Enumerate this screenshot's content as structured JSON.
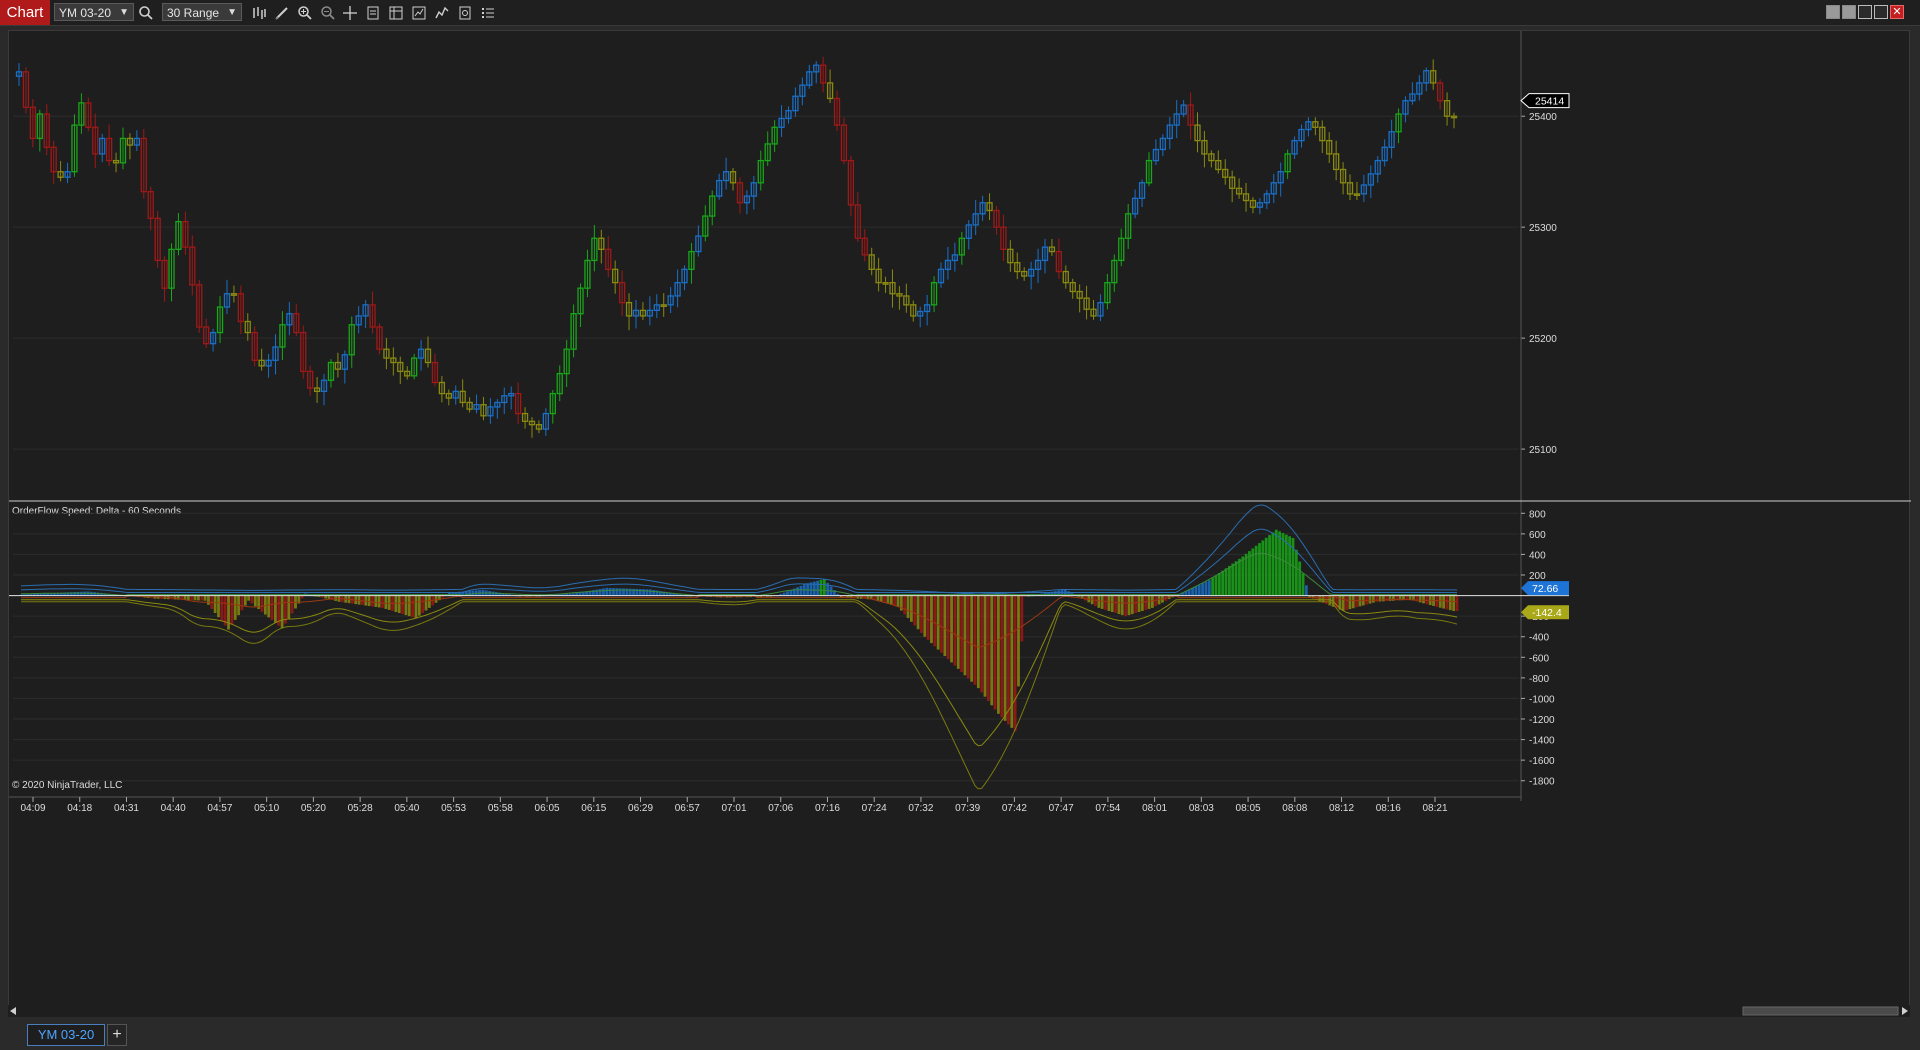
{
  "toolbar": {
    "chart_tab": "Chart",
    "instrument": "YM 03-20",
    "bar_type": "30 Range",
    "icons": [
      "search-icon",
      "bar-style-icon",
      "draw-pencil-icon",
      "zoom-in-icon",
      "zoom-out-icon",
      "crosshair-icon",
      "properties-icon",
      "templates-icon",
      "strategies-icon",
      "indicators-icon",
      "data-box-icon",
      "object-tree-icon"
    ]
  },
  "window_buttons": [
    "tile-icon",
    "restore-icon",
    "minimize-icon",
    "maximize-icon",
    "close-icon"
  ],
  "colors": {
    "background": "#1e1e1e",
    "up_strong": "#18a818",
    "up_blue": "#1a6fc7",
    "down_red": "#a01818",
    "neutral_olive": "#8a8a10",
    "grid": "#2c2c2c",
    "price_marker": "#ffffff",
    "delta_pos_label": "#1d74d6",
    "delta_neg_label": "#a8a818"
  },
  "chart_data": [
    {
      "type": "candlestick",
      "panel": "price",
      "ylim": [
        25055,
        25475
      ],
      "yticks": [
        25100,
        25200,
        25300,
        25400
      ],
      "current_price": "25414",
      "x_tick_labels": [
        "04:09",
        "04:18",
        "04:31",
        "04:40",
        "04:57",
        "05:10",
        "05:20",
        "05:28",
        "05:40",
        "05:53",
        "05:58",
        "06:05",
        "06:15",
        "06:29",
        "06:57",
        "07:01",
        "07:06",
        "07:16",
        "07:24",
        "07:32",
        "07:39",
        "07:42",
        "07:47",
        "07:54",
        "08:01",
        "08:03",
        "08:05",
        "08:08",
        "08:12",
        "08:16",
        "08:21"
      ],
      "close_path": [
        25440,
        25408,
        25380,
        25402,
        25372,
        25350,
        25345,
        25350,
        25392,
        25412,
        25390,
        25366,
        25380,
        25360,
        25358,
        25380,
        25374,
        25380,
        25332,
        25308,
        25270,
        25245,
        25280,
        25305,
        25282,
        25248,
        25210,
        25195,
        25205,
        25228,
        25240,
        25240,
        25215,
        25205,
        25180,
        25175,
        25180,
        25192,
        25212,
        25222,
        25205,
        25170,
        25155,
        25152,
        25162,
        25178,
        25172,
        25185,
        25212,
        25220,
        25230,
        25210,
        25190,
        25182,
        25178,
        25170,
        25166,
        25182,
        25190,
        25178,
        25160,
        25150,
        25146,
        25152,
        25142,
        25136,
        25140,
        25130,
        25138,
        25142,
        25148,
        25150,
        25132,
        25125,
        25122,
        25118,
        25132,
        25150,
        25168,
        25190,
        25222,
        25245,
        25270,
        25290,
        25280,
        25262,
        25250,
        25232,
        25220,
        25225,
        25220,
        25225,
        25230,
        25230,
        25238,
        25250,
        25262,
        25278,
        25292,
        25310,
        25328,
        25342,
        25350,
        25340,
        25322,
        25328,
        25340,
        25360,
        25375,
        25390,
        25398,
        25405,
        25418,
        25428,
        25440,
        25446,
        25430,
        25416,
        25392,
        25360,
        25320,
        25290,
        25275,
        25262,
        25250,
        25250,
        25240,
        25238,
        25230,
        25220,
        25224,
        25230,
        25250,
        25262,
        25270,
        25275,
        25290,
        25302,
        25312,
        25322,
        25315,
        25300,
        25280,
        25268,
        25260,
        25256,
        25262,
        25270,
        25282,
        25278,
        25260,
        25250,
        25242,
        25236,
        25226,
        25220,
        25232,
        25250,
        25270,
        25290,
        25312,
        25326,
        25340,
        25360,
        25370,
        25380,
        25392,
        25402,
        25410,
        25392,
        25378,
        25366,
        25360,
        25352,
        25345,
        25335,
        25330,
        25324,
        25318,
        25322,
        25330,
        25340,
        25350,
        25366,
        25378,
        25388,
        25395,
        25390,
        25378,
        25366,
        25352,
        25340,
        25330,
        25330,
        25338,
        25348,
        25360,
        25372,
        25386,
        25402,
        25414,
        25420,
        25430,
        25441,
        25430,
        25414,
        25400,
        25400
      ]
    },
    {
      "type": "bar+line",
      "panel": "indicator",
      "title": "OrderFlow Speed: Delta - 60 Seconds",
      "ylim": [
        -1900,
        900
      ],
      "yticks": [
        800,
        600,
        400,
        200,
        -200,
        -400,
        -600,
        -800,
        -1000,
        -1200,
        -1400,
        -1600,
        -1800
      ],
      "labels": {
        "positive": "72.66",
        "negative": "-142.4"
      },
      "delta_keypoints": [
        [
          0,
          10
        ],
        [
          20,
          40
        ],
        [
          40,
          -30
        ],
        [
          55,
          -50
        ],
        [
          62,
          -330
        ],
        [
          68,
          -50
        ],
        [
          78,
          -320
        ],
        [
          85,
          20
        ],
        [
          95,
          -60
        ],
        [
          108,
          -120
        ],
        [
          118,
          -220
        ],
        [
          128,
          30
        ],
        [
          138,
          55
        ],
        [
          150,
          -10
        ],
        [
          165,
          20
        ],
        [
          175,
          75
        ],
        [
          188,
          60
        ],
        [
          200,
          -5
        ],
        [
          210,
          -20
        ],
        [
          225,
          -10
        ],
        [
          235,
          120
        ],
        [
          240,
          160
        ],
        [
          245,
          -20
        ],
        [
          255,
          -40
        ],
        [
          262,
          -110
        ],
        [
          270,
          -400
        ],
        [
          278,
          -650
        ],
        [
          286,
          -900
        ],
        [
          292,
          -1150
        ],
        [
          297,
          -1320
        ],
        [
          300,
          -10
        ],
        [
          312,
          60
        ],
        [
          322,
          -120
        ],
        [
          330,
          -200
        ],
        [
          338,
          -120
        ],
        [
          345,
          0
        ],
        [
          355,
          150
        ],
        [
          365,
          380
        ],
        [
          375,
          640
        ],
        [
          380,
          560
        ],
        [
          385,
          -15
        ],
        [
          395,
          -150
        ],
        [
          405,
          -60
        ],
        [
          415,
          -40
        ],
        [
          423,
          -110
        ],
        [
          428,
          -150
        ]
      ],
      "upper_band_peak": 820,
      "lower_band_trough": -1820
    }
  ],
  "copyright": "© 2020 NinjaTrader, LLC",
  "bottom": {
    "instrument_tab": "YM 03-20",
    "add_tab": "+"
  }
}
